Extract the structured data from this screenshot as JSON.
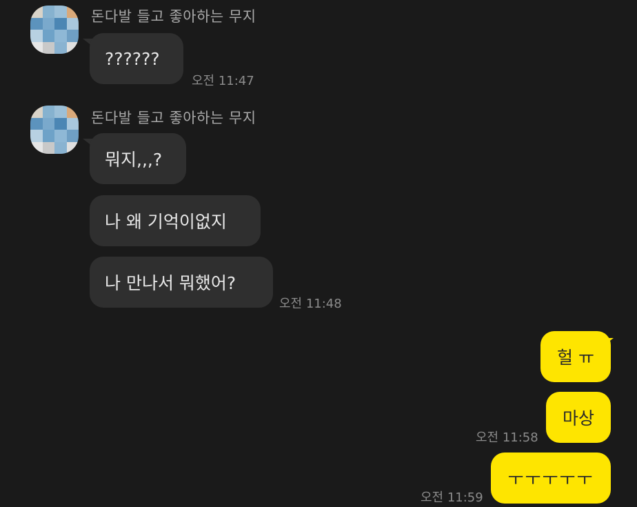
{
  "chat": {
    "groups": [
      {
        "sender_name": "돈다발 들고 좋아하는 무지",
        "messages": [
          "??????"
        ],
        "time": "오전 11:47"
      },
      {
        "sender_name": "돈다발 들고 좋아하는 무지",
        "messages": [
          "뭐지,,,?",
          "나 왜 기억이없지",
          "나 만나서 뭐했어?"
        ],
        "time": "오전 11:48"
      }
    ],
    "my_messages": [
      {
        "text": "헐 ㅠ",
        "time": ""
      },
      {
        "text": "마상",
        "time": "오전 11:58"
      },
      {
        "text": "ㅜㅜㅜㅜㅜ",
        "time": "오전 11:59"
      }
    ]
  },
  "colors": {
    "background": "#1a1a1a",
    "incoming_bubble": "#2f2f2f",
    "outgoing_bubble": "#fee500",
    "time_text": "#8c8c8c",
    "sender_text": "#a9a9a9"
  }
}
